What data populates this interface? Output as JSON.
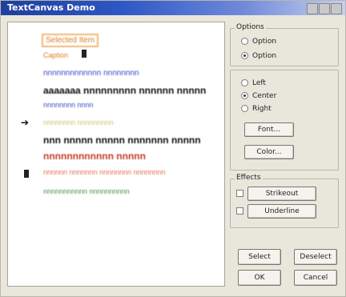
{
  "window": {
    "title": "TextCanvas Demo",
    "controls": [
      "minimize",
      "maximize",
      "close"
    ]
  },
  "canvas": {
    "lines": [
      {
        "text": "Selected Item",
        "color": "#e07b1e",
        "size": 10,
        "weight": "normal",
        "boxed": true
      },
      {
        "text": "Caption",
        "color": "#e07b1e",
        "size": 9,
        "weight": "normal"
      },
      {
        "text": "nnnnnnnnnnnnn nnnnnnnn",
        "color": "#3b46c8",
        "size": 10,
        "weight": "normal"
      },
      {
        "text": "aaaaaaa nnnnnnnnn nnnnnn nnnnn",
        "color": "#111111",
        "size": 12,
        "weight": "bold"
      },
      {
        "text": "nnnnnnnn nnnn",
        "color": "#3b46c8",
        "size": 9,
        "weight": "normal"
      },
      {
        "text": "nnnnnnnn nnnnnnnnn",
        "color": "#c9c55a",
        "size": 9,
        "weight": "normal"
      },
      {
        "text": "nnn nnnnn nnnnn nnnnnnn nnnnn",
        "color": "#111111",
        "size": 12,
        "weight": "bold"
      },
      {
        "text": "nnnnnnnnnnnn nnnnn",
        "color": "#c43d2a",
        "size": 12,
        "weight": "bold"
      },
      {
        "text": "nnnnnn nnnnnnn nnnnnnnn nnnnnnnn",
        "color": "#e86a5a",
        "size": 9,
        "weight": "normal"
      },
      {
        "text": "nnnnnnnnnnn nnnnnnnnnn",
        "color": "#3c8f3c",
        "size": 9,
        "weight": "normal"
      }
    ],
    "marker_arrow": "➔"
  },
  "panel": {
    "group1": {
      "legend": "Options",
      "radios": [
        {
          "label": "Option",
          "checked": false
        },
        {
          "label": "Option",
          "checked": true
        }
      ]
    },
    "group2": {
      "radios": [
        {
          "label": "Left",
          "checked": false
        },
        {
          "label": "Center",
          "checked": true
        },
        {
          "label": "Right",
          "checked": false
        }
      ],
      "buttons": [
        "Font...",
        "Color..."
      ]
    },
    "group3": {
      "legend": "Effects",
      "checks": [
        {
          "label": "Strikeout",
          "checked": false
        },
        {
          "label": "Underline",
          "checked": false
        }
      ]
    },
    "bottom_buttons": [
      "Select",
      "Deselect",
      "OK",
      "Cancel"
    ]
  }
}
